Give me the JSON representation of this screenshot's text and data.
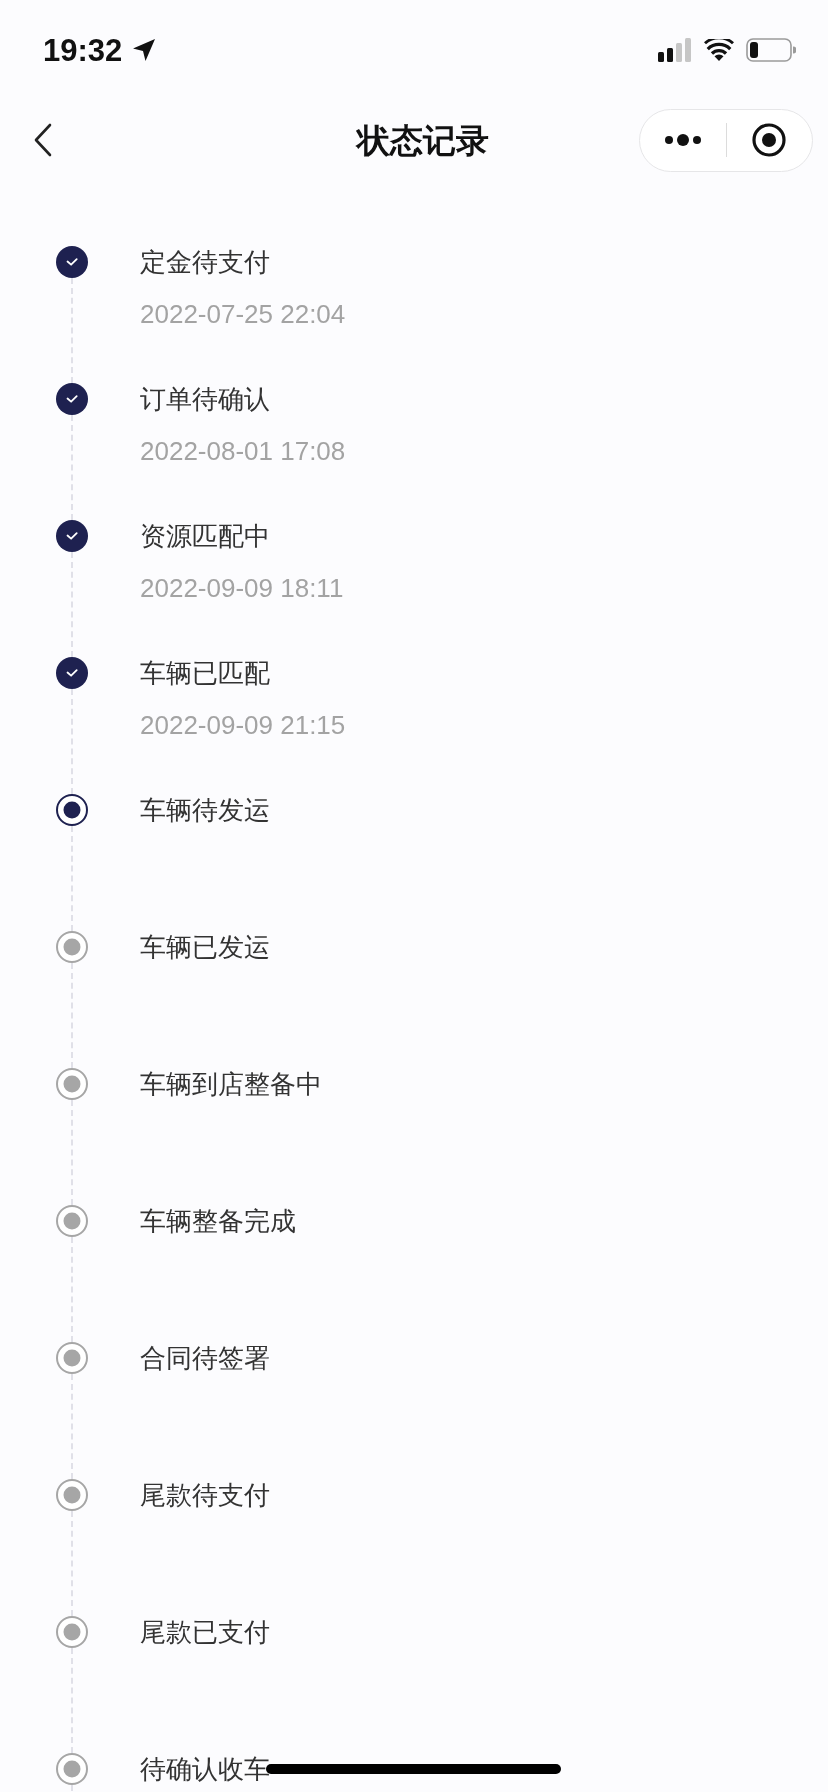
{
  "status_bar": {
    "time": "19:32"
  },
  "nav": {
    "title": "状态记录"
  },
  "timeline": [
    {
      "kind": "done",
      "label": "定金待支付",
      "time": "2022-07-25 22:04"
    },
    {
      "kind": "done",
      "label": "订单待确认",
      "time": "2022-08-01 17:08"
    },
    {
      "kind": "done",
      "label": "资源匹配中",
      "time": "2022-09-09 18:11"
    },
    {
      "kind": "done",
      "label": "车辆已匹配",
      "time": "2022-09-09 21:15"
    },
    {
      "kind": "current",
      "label": "车辆待发运"
    },
    {
      "kind": "pending",
      "label": "车辆已发运"
    },
    {
      "kind": "pending",
      "label": "车辆到店整备中"
    },
    {
      "kind": "pending",
      "label": "车辆整备完成"
    },
    {
      "kind": "pending",
      "label": "合同待签署"
    },
    {
      "kind": "pending",
      "label": "尾款待支付"
    },
    {
      "kind": "pending",
      "label": "尾款已支付"
    },
    {
      "kind": "pending",
      "label": "待确认收车"
    }
  ]
}
